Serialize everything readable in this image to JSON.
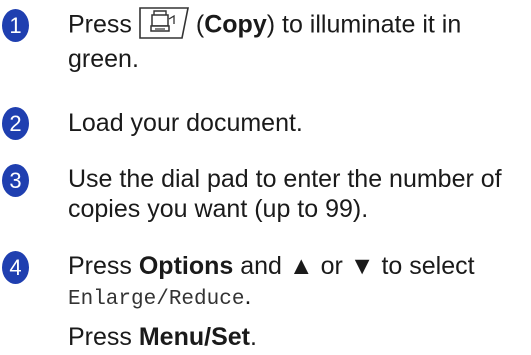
{
  "colors": {
    "badge_fill": "#1f3fb0",
    "badge_text": "#ffffff",
    "body_text": "#1a1a1a"
  },
  "steps": [
    {
      "number": "1",
      "line1_pre": "Press",
      "icon": "copy-key-icon",
      "line1_paren_open": "(",
      "line1_bold": "Copy",
      "line1_paren_close": ")",
      "line1_post": " to illuminate it in",
      "line2": "green."
    },
    {
      "number": "2",
      "text": "Load your document."
    },
    {
      "number": "3",
      "line1": "Use the dial pad to enter the number of",
      "line2": "copies you want (up to 99)."
    },
    {
      "number": "4",
      "pre": "Press ",
      "bold": "Options",
      "mid": " and ▲ or ▼ to select",
      "mono": "Enlarge/Reduce",
      "mono_tail": ".",
      "followup_pre": "Press ",
      "followup_bold": "Menu/Set",
      "followup_tail": "."
    }
  ]
}
